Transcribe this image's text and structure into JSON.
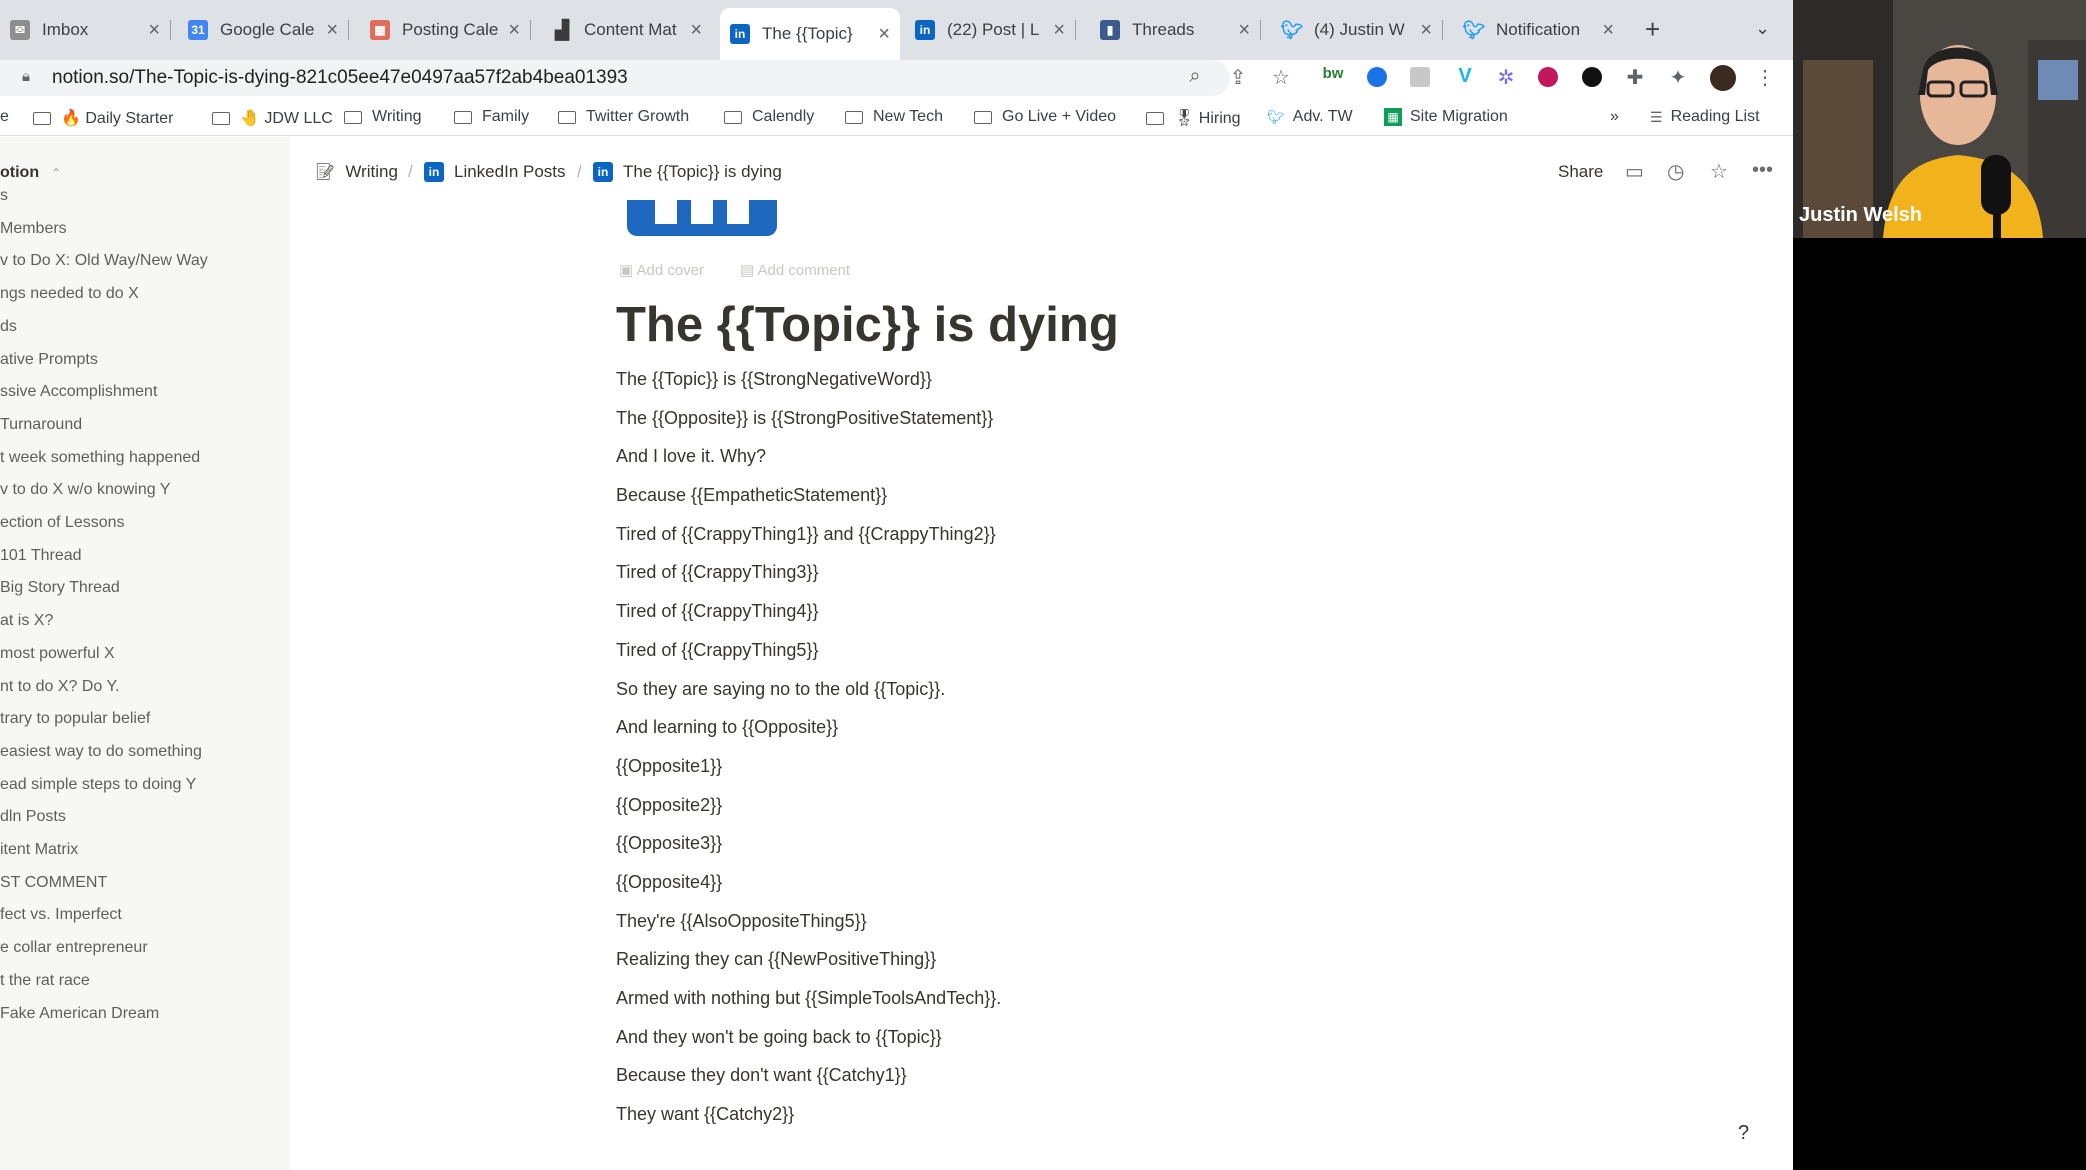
{
  "tabs": [
    {
      "label": "Imbox",
      "icon": "mail-icon",
      "color": "#8e8e8e"
    },
    {
      "label": "Google Cale",
      "icon": "calendar-icon",
      "color": "#4285f4"
    },
    {
      "label": "Posting Cale",
      "icon": "calendar-icon",
      "color": "#e06c5b"
    },
    {
      "label": "Content Mat",
      "icon": "chart-icon",
      "color": "#3b3b3b"
    },
    {
      "label": "The {{Topic}",
      "icon": "linkedin-icon",
      "color": "#0a66c2"
    },
    {
      "label": "(22) Post | L",
      "icon": "linkedin-icon",
      "color": "#0a66c2"
    },
    {
      "label": "Threads",
      "icon": "bookmark-icon",
      "color": "#3b5b8c"
    },
    {
      "label": "(4) Justin W",
      "icon": "twitter-icon",
      "color": "#1d9bf0"
    },
    {
      "label": "Notification",
      "icon": "twitter-icon",
      "color": "#1d9bf0"
    }
  ],
  "address_bar": {
    "url": "notion.so/The-Topic-is-dying-821c05ee47e0497aa57f2ab4bea01393"
  },
  "bookmarks": [
    {
      "label": "e",
      "type": "text"
    },
    {
      "label": "🔥 Daily Starter",
      "type": "folder"
    },
    {
      "label": "🤚 JDW LLC",
      "type": "folder"
    },
    {
      "label": "Writing",
      "type": "folder"
    },
    {
      "label": "Family",
      "type": "folder"
    },
    {
      "label": "Twitter Growth",
      "type": "folder"
    },
    {
      "label": "Calendly",
      "type": "folder"
    },
    {
      "label": "New Tech",
      "type": "folder"
    },
    {
      "label": "Go Live + Video",
      "type": "folder"
    },
    {
      "label": "🎖 Hiring",
      "type": "folder"
    },
    {
      "label": "Adv. TW",
      "type": "twitter"
    },
    {
      "label": "Site Migration",
      "type": "sheet"
    }
  ],
  "bookmarks_overflow": "»",
  "reading_list": "Reading List",
  "sidebar": {
    "workspace": "otion",
    "items": [
      "s",
      "Members",
      "v to Do X: Old Way/New Way",
      "ngs needed to do X",
      "ds",
      "ative Prompts",
      "ssive Accomplishment",
      " Turnaround",
      "t week something happened",
      "v to do X w/o knowing Y",
      "ection of Lessons",
      " 101 Thread",
      " Big Story Thread",
      "at is X?",
      " most powerful X",
      "nt to do X? Do Y.",
      "trary to popular belief",
      " easiest way to do something",
      "ead simple steps to doing Y",
      "dln Posts",
      "itent Matrix",
      "ST COMMENT",
      "fect vs. Imperfect",
      "e collar entrepreneur",
      "t the rat race",
      " Fake American Dream"
    ]
  },
  "breadcrumbs": [
    "Writing",
    "LinkedIn Posts",
    "The {{Topic}} is dying"
  ],
  "topbar": {
    "share": "Share"
  },
  "page": {
    "add_cover": "Add cover",
    "add_comment": "Add comment",
    "title": "The {{Topic}} is dying",
    "lines": [
      "The {{Topic}} is {{StrongNegativeWord}}",
      "The {{Opposite}} is {{StrongPositiveStatement}}",
      "And I love it. Why?",
      "Because {{EmpatheticStatement}}",
      "Tired of {{CrappyThing1}} and {{CrappyThing2}}",
      "Tired of {{CrappyThing3}}",
      "Tired of {{CrappyThing4}}",
      "Tired of {{CrappyThing5}}",
      "So they are saying no to the old {{Topic}}.",
      "And learning to {{Opposite}}",
      "{{Opposite1}}",
      "{{Opposite2}}",
      "{{Opposite3}}",
      "{{Opposite4}}",
      "They're {{AlsoOppositeThing5}}",
      "Realizing they can {{NewPositiveThing}}",
      "Armed with nothing but {{SimpleToolsAndTech}}.",
      "And they won't be going back to {{Topic}}",
      "Because they don't want {{Catchy1}}",
      "They want {{Catchy2}}"
    ]
  },
  "help": "?",
  "webcam": {
    "name": "Justin Welsh"
  }
}
